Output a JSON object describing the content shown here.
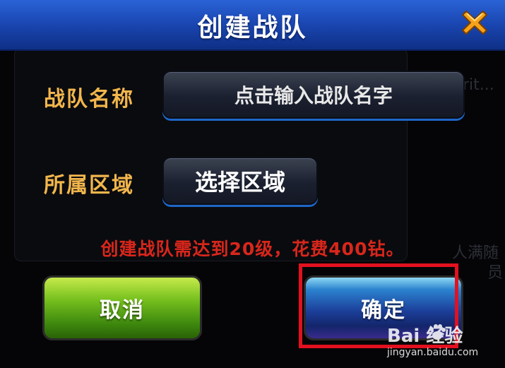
{
  "dialog": {
    "title": "创建战队",
    "close_icon": "close-x-icon",
    "team_name_label": "战队名称",
    "team_name_placeholder": "点击输入战队名字",
    "region_label": "所属区域",
    "region_value": "选择区域",
    "notice": "创建战队需达到20级，花费400钻。",
    "cancel_label": "取消",
    "confirm_label": "确定"
  },
  "background": {
    "right_text_1": "rit...",
    "right_text_2": "人满随",
    "right_text_3": "员"
  },
  "watermark": {
    "logo": "Bai 经验",
    "url": "jingyan.baidu.com"
  },
  "colors": {
    "title_bar": "#1b48b4",
    "label": "#f2b64c",
    "notice": "#d9261b",
    "cancel_button": "#79c21f",
    "confirm_button": "#1c3f9a",
    "highlight_box": "#e3101f"
  }
}
